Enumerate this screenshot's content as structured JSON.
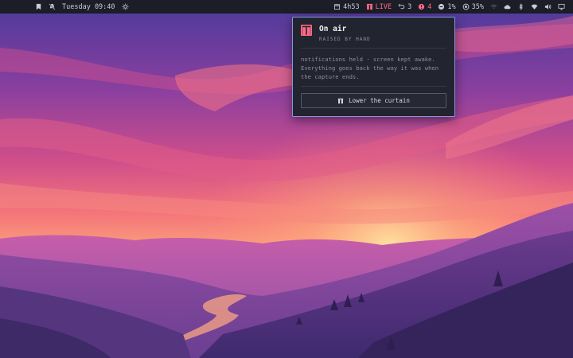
{
  "topbar": {
    "left": {
      "day_time": "Tuesday 09:40",
      "icons": [
        "bookmark-icon",
        "bell-muted-icon",
        "brightness-icon"
      ]
    },
    "right": {
      "timer": "4h53",
      "live_label": "LIVE",
      "undo_count": "3",
      "alert_count": "4",
      "dnd_value": "1%",
      "battery_value": "35%",
      "icons": [
        "calendar-icon",
        "curtain-icon",
        "undo-icon",
        "alert-icon",
        "minus-circle-icon",
        "battery-icon",
        "wifi-off-icon",
        "cloud-icon",
        "bluetooth-icon",
        "wifi-icon",
        "volume-icon",
        "display-icon"
      ]
    }
  },
  "popup": {
    "title": "On air",
    "subtitle": "RAISED BY HAND",
    "body": "notifications held · screen kept awake. Everything goes back the way it was when the capture ends.",
    "button_label": "Lower the curtain",
    "accent": "#ff6b87",
    "border_color": "#8a97e8"
  }
}
